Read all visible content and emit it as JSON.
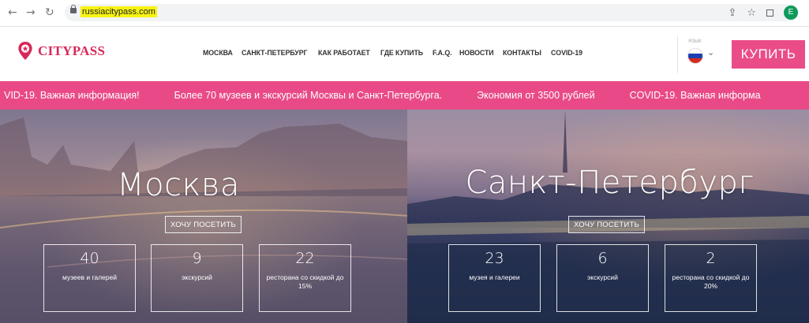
{
  "browser": {
    "back_icon": "arrow-left-icon",
    "forward_icon": "arrow-right-icon",
    "reload_icon": "reload-icon",
    "url": "russiacitypass.com",
    "share_icon": "share-icon",
    "bookmark_icon": "star-icon",
    "sidepanel_icon": "sidepanel-icon",
    "profile_initial": "E",
    "profile_color": "#0d9a5b"
  },
  "header": {
    "logo_text": "CITYPASS",
    "nav": [
      "МОСКВА",
      "САНКТ-ПЕТЕРБУРГ",
      "КАК РАБОТАЕТ",
      "ГДЕ КУПИТЬ",
      "F.A.Q.",
      "НОВОСТИ",
      "КОНТАКТЫ",
      "COVID-19"
    ],
    "lang_label": "ЯЗЫК",
    "buy_label": "КУПИТЬ",
    "brand_color": "#ea4c89"
  },
  "ticker": {
    "items": [
      "VID-19. Важная информация!",
      "Более 70 музеев и экскурсий Москвы и Санкт-Петербурга.",
      "Экономия от 3500 рублей",
      "COVID-19. Важная информа"
    ]
  },
  "cities": [
    {
      "name": "Москва",
      "button": "ХОЧУ ПОСЕТИТЬ",
      "stats": [
        {
          "value": "40",
          "label": "музеев и галерей"
        },
        {
          "value": "9",
          "label": "экскурсий"
        },
        {
          "value": "22",
          "label": "ресторана со скидкой до 15%"
        }
      ]
    },
    {
      "name": "Санкт-Петербург",
      "button": "ХОЧУ ПОСЕТИТЬ",
      "stats": [
        {
          "value": "23",
          "label": "музея и галереи"
        },
        {
          "value": "6",
          "label": "экскурсий"
        },
        {
          "value": "2",
          "label": "ресторана со скидкой до 20%"
        }
      ]
    }
  ]
}
